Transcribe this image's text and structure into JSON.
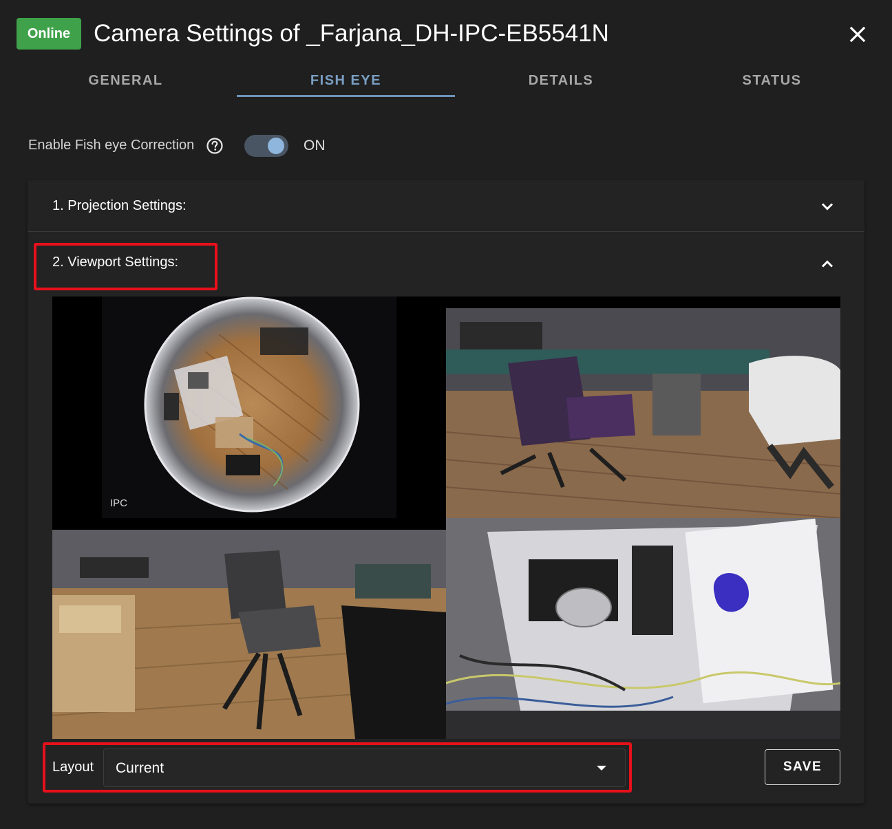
{
  "header": {
    "status_badge": "Online",
    "title": "Camera Settings of _Farjana_DH-IPC-EB5541N",
    "close_icon": "close-icon"
  },
  "tabs": [
    {
      "label": "GENERAL",
      "active": false
    },
    {
      "label": "FISH EYE",
      "active": true
    },
    {
      "label": "DETAILS",
      "active": false
    },
    {
      "label": "STATUS",
      "active": false
    }
  ],
  "fisheye": {
    "label": "Enable Fish eye Correction",
    "help_icon": "help-circle-icon",
    "toggle_on": true,
    "toggle_state": "ON"
  },
  "accordion": [
    {
      "title": "1. Projection Settings:",
      "expanded": false,
      "icon": "chevron-down-icon"
    },
    {
      "title": "2. Viewport Settings:",
      "expanded": true,
      "icon": "chevron-up-icon"
    }
  ],
  "viewport": {
    "fisheye_watermark": "IPC"
  },
  "layout": {
    "label": "Layout",
    "value": "Current",
    "arrow_icon": "dropdown-arrow-icon"
  },
  "save_label": "SAVE",
  "colors": {
    "badge": "#3fa24b",
    "accent": "#7a9ec2",
    "highlight": "#e8101b",
    "background": "#1f1f1f"
  }
}
